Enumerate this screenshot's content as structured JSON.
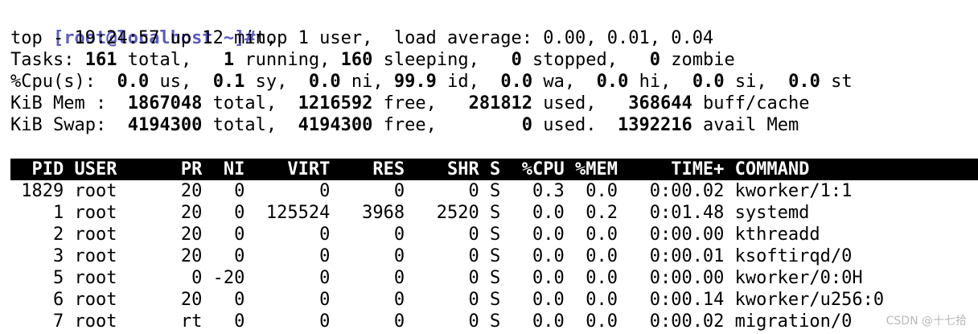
{
  "prompt": {
    "text": "[root@localhost ~]#",
    "command": "top"
  },
  "summary": {
    "uptime_line": "top - 19:24:57 up 12 min,  1 user,  load average: 0.00, 0.01, 0.04",
    "tasks": {
      "label": "Tasks: ",
      "total": "161",
      "total_label": " total,   ",
      "running": "1",
      "running_label": " running, ",
      "sleeping": "160",
      "sleeping_label": " sleeping,   ",
      "stopped": "0",
      "stopped_label": " stopped,   ",
      "zombie": "0",
      "zombie_label": " zombie"
    },
    "cpu": {
      "label": "%Cpu(s):  ",
      "us": "0.0",
      "us_label": " us,  ",
      "sy": "0.1",
      "sy_label": " sy,  ",
      "ni": "0.0",
      "ni_label": " ni, ",
      "id": "99.9",
      "id_label": " id,  ",
      "wa": "0.0",
      "wa_label": " wa,  ",
      "hi": "0.0",
      "hi_label": " hi,  ",
      "si": "0.0",
      "si_label": " si,  ",
      "st": "0.0",
      "st_label": " st"
    },
    "mem": {
      "label": "KiB Mem :  ",
      "total": "1867048",
      "total_label": " total,  ",
      "free": "1216592",
      "free_label": " free,   ",
      "used": "281812",
      "used_label": " used,   ",
      "buff": "368644",
      "buff_label": " buff/cache"
    },
    "swap": {
      "label": "KiB Swap:  ",
      "total": "4194300",
      "total_label": " total,  ",
      "free": "4194300",
      "free_label": " free,        ",
      "used": "0",
      "used_label": " used.  ",
      "avail": "1392216",
      "avail_label": " avail Mem"
    }
  },
  "table": {
    "header": "  PID USER      PR  NI    VIRT    RES    SHR S  %CPU %MEM     TIME+ COMMAND",
    "rows": [
      " 1829 root      20   0       0      0      0 S   0.3  0.0   0:00.02 kworker/1:1",
      "    1 root      20   0  125524   3968   2520 S   0.0  0.2   0:01.48 systemd",
      "    2 root      20   0       0      0      0 S   0.0  0.0   0:00.00 kthreadd",
      "    3 root      20   0       0      0      0 S   0.0  0.0   0:00.01 ksoftirqd/0",
      "    5 root       0 -20       0      0      0 S   0.0  0.0   0:00.00 kworker/0:0H",
      "    6 root      20   0       0      0      0 S   0.0  0.0   0:00.14 kworker/u256:0",
      "    7 root      rt   0       0      0      0 S   0.0  0.0   0:00.02 migration/0"
    ]
  },
  "watermark": "CSDN @十七拾"
}
